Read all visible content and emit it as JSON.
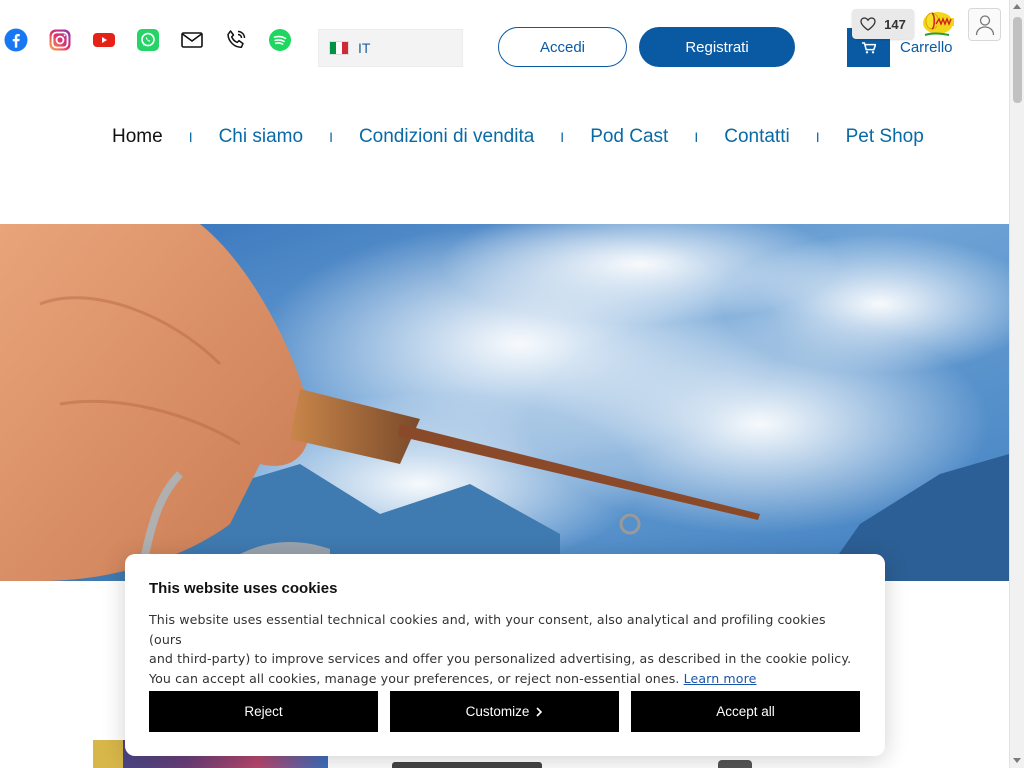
{
  "header": {
    "social": [
      {
        "icon": "facebook-icon",
        "color": "#1877f2"
      },
      {
        "icon": "instagram-icon",
        "color": "#d6249f"
      },
      {
        "icon": "youtube-icon",
        "color": "#e62117"
      },
      {
        "icon": "whatsapp-icon",
        "color": "#25d366"
      },
      {
        "icon": "mail-icon",
        "color": "#111111"
      },
      {
        "icon": "phone-icon",
        "color": "#111111"
      },
      {
        "icon": "spotify-icon",
        "color": "#1ed760"
      }
    ],
    "language": {
      "code": "IT",
      "flag": "italy-flag-icon"
    },
    "login_label": "Accedi",
    "register_label": "Registrati",
    "cart_label": "Carrello",
    "favorites_count": "147",
    "brand_color": "#0a5aa3"
  },
  "nav": {
    "items": [
      {
        "label": "Home",
        "active": true
      },
      {
        "label": "Chi siamo"
      },
      {
        "label": "Condizioni di vendita"
      },
      {
        "label": "Pod Cast"
      },
      {
        "label": "Contatti"
      },
      {
        "label": "Pet Shop"
      }
    ],
    "separator": "I"
  },
  "cookie_banner": {
    "title": "This website uses cookies",
    "body_line1": "This website uses essential technical cookies and, with your consent, also analytical and profiling cookies (ours",
    "body_line2": "and third-party) to improve services and offer you personalized advertising, as described in the cookie policy.",
    "body_line3": "You can accept all cookies, manage your preferences, or reject non-essential ones.",
    "learn_more": "Learn more",
    "reject_label": "Reject",
    "customize_label": "Customize",
    "accept_label": "Accept all"
  }
}
